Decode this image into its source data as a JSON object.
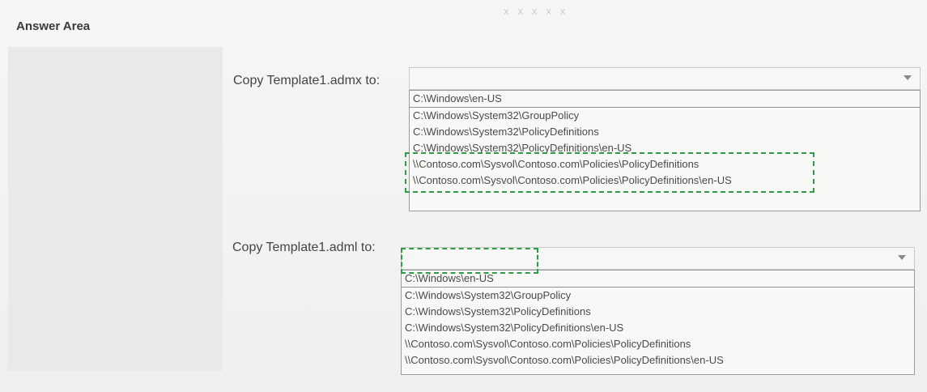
{
  "panel": {
    "title": "Answer Area"
  },
  "header": {
    "text": "X X X X X"
  },
  "fields": [
    {
      "label": "Copy Template1.admx to:",
      "options": [
        "C:\\Windows\\en-US",
        "C:\\Windows\\System32\\GroupPolicy",
        "C:\\Windows\\System32\\PolicyDefinitions",
        "C:\\Windows\\System32\\PolicyDefinitions\\en-US",
        "\\\\Contoso.com\\Sysvol\\Contoso.com\\Policies\\PolicyDefinitions",
        "\\\\Contoso.com\\Sysvol\\Contoso.com\\Policies\\PolicyDefinitions\\en-US"
      ]
    },
    {
      "label": "Copy Template1.adml to:",
      "options": [
        "C:\\Windows\\en-US",
        "C:\\Windows\\System32\\GroupPolicy",
        "C:\\Windows\\System32\\PolicyDefinitions",
        "C:\\Windows\\System32\\PolicyDefinitions\\en-US",
        "\\\\Contoso.com\\Sysvol\\Contoso.com\\Policies\\PolicyDefinitions",
        "\\\\Contoso.com\\Sysvol\\Contoso.com\\Policies\\PolicyDefinitions\\en-US"
      ]
    }
  ],
  "colors": {
    "highlight": "#2f9b49"
  }
}
